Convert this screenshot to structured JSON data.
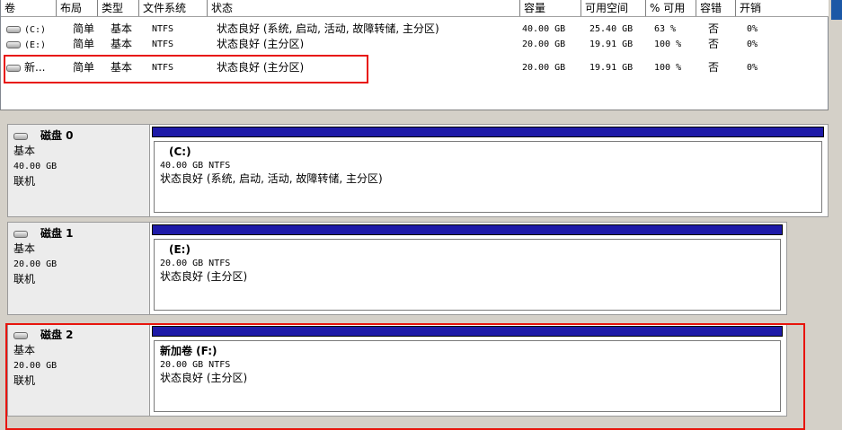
{
  "volume_list": {
    "columns": [
      "卷",
      "布局",
      "类型",
      "文件系统",
      "状态",
      "容量",
      "可用空间",
      "% 可用",
      "容错",
      "开销"
    ],
    "rows": [
      {
        "volume": "(C:)",
        "layout": "简单",
        "type": "基本",
        "fs": "NTFS",
        "status": "状态良好 (系统, 启动, 活动, 故障转储, 主分区)",
        "capacity": "40.00 GB",
        "free": "25.40 GB",
        "pct_free": "63 %",
        "fault_tolerance": "否",
        "overhead": "0%"
      },
      {
        "volume": "(E:)",
        "layout": "简单",
        "type": "基本",
        "fs": "NTFS",
        "status": "状态良好 (主分区)",
        "capacity": "20.00 GB",
        "free": "19.91 GB",
        "pct_free": "100 %",
        "fault_tolerance": "否",
        "overhead": "0%"
      },
      {
        "volume": "新...",
        "layout": "简单",
        "type": "基本",
        "fs": "NTFS",
        "status": "状态良好 (主分区)",
        "capacity": "20.00 GB",
        "free": "19.91 GB",
        "pct_free": "100 %",
        "fault_tolerance": "否",
        "overhead": "0%"
      }
    ]
  },
  "disks": [
    {
      "name": "磁盘 0",
      "type": "基本",
      "size": "40.00 GB",
      "state": "联机",
      "partition": {
        "label": "(C:)",
        "detail": "40.00 GB NTFS",
        "status": "状态良好 (系统, 启动, 活动, 故障转储, 主分区)"
      }
    },
    {
      "name": "磁盘 1",
      "type": "基本",
      "size": "20.00 GB",
      "state": "联机",
      "partition": {
        "label": "(E:)",
        "detail": "20.00 GB NTFS",
        "status": "状态良好 (主分区)"
      }
    },
    {
      "name": "磁盘 2",
      "type": "基本",
      "size": "20.00 GB",
      "state": "联机",
      "partition": {
        "label": "新加卷  (F:)",
        "detail": "20.00 GB NTFS",
        "status": "状态良好 (主分区)"
      }
    }
  ],
  "colors": {
    "highlight": "#e8140c",
    "partition_cap": "#1e1aa8",
    "panel_bg": "#d4d0c8"
  },
  "icons": {
    "disk": "hard-drive-icon"
  }
}
